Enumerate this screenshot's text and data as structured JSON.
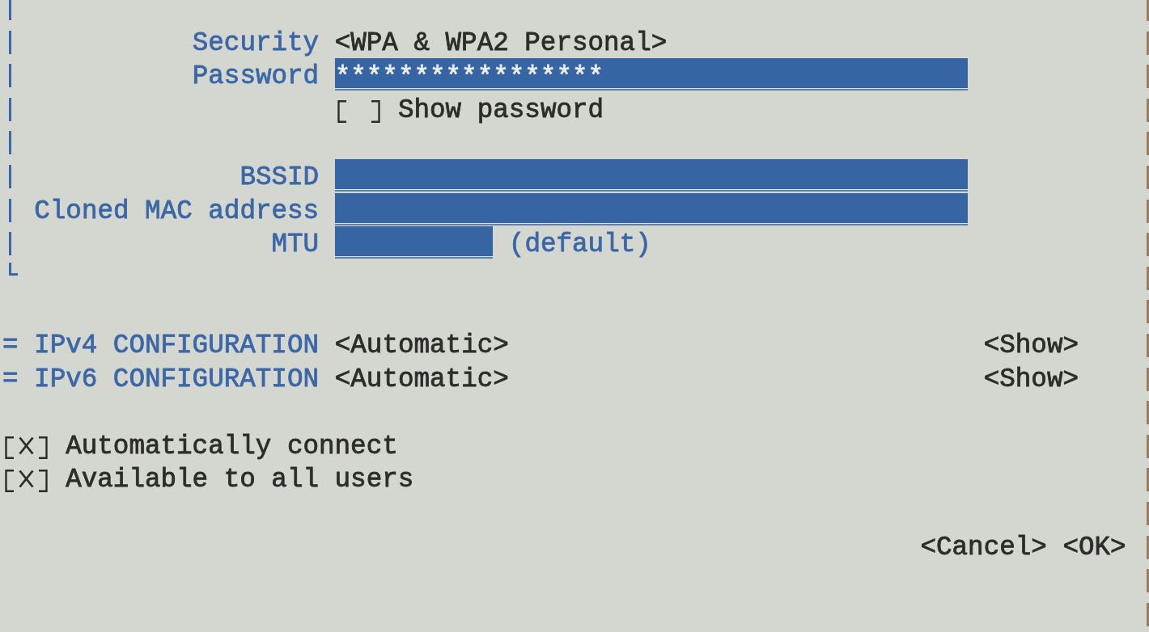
{
  "wifi_security": {
    "groups": [
      {
        "rows": [
          {
            "kind": "dropdown",
            "label": "Security",
            "value": "<WPA & WPA2 Personal>"
          },
          {
            "kind": "field",
            "label": "Password",
            "value": "*****************"
          },
          {
            "kind": "checkbox",
            "label": "Show password",
            "checked": false
          }
        ]
      },
      {
        "rows": [
          {
            "kind": "field",
            "label": "BSSID"
          },
          {
            "kind": "field",
            "label": "Cloned MAC address"
          },
          {
            "kind": "short_field",
            "label": "MTU",
            "note": "(default)"
          }
        ]
      }
    ]
  },
  "sections": [
    {
      "marker": "=",
      "title": "IPv4 CONFIGURATION",
      "mode": "<Automatic>",
      "toggle": "<Show>"
    },
    {
      "marker": "=",
      "title": "IPv6 CONFIGURATION",
      "mode": "<Automatic>",
      "toggle": "<Show>"
    }
  ],
  "options": [
    {
      "label": "Automatically connect",
      "checked": true
    },
    {
      "label": "Available to all users",
      "checked": true
    }
  ],
  "buttons": [
    "<Cancel>",
    "<OK>"
  ]
}
